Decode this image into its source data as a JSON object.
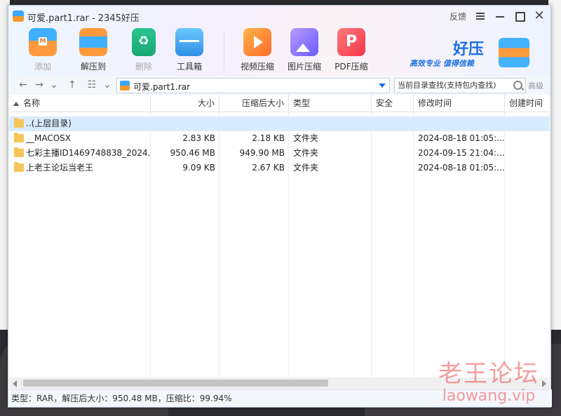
{
  "window": {
    "title": "可爱.part1.rar - 2345好压"
  },
  "titlebar": {
    "feedback_label": "反馈"
  },
  "toolbar": {
    "items": [
      {
        "label": "添加",
        "icon": "add-archive-icon",
        "enabled": false
      },
      {
        "label": "解压到",
        "icon": "extract-icon",
        "enabled": true
      },
      {
        "label": "删除",
        "icon": "delete-icon",
        "enabled": false
      },
      {
        "label": "工具箱",
        "icon": "toolbox-icon",
        "enabled": true
      },
      {
        "label": "视频压缩",
        "icon": "video-compress-icon",
        "enabled": true
      },
      {
        "label": "图片压缩",
        "icon": "image-compress-icon",
        "enabled": true
      },
      {
        "label": "PDF压缩",
        "icon": "pdf-compress-icon",
        "enabled": true
      }
    ]
  },
  "brand": {
    "name": "好压",
    "slogan": "高效专业 值得信赖"
  },
  "nav": {
    "path": "可爱.part1.rar",
    "search_placeholder": "当前目录查找(支持包内查找)",
    "advanced_label": "高级"
  },
  "columns": [
    "名称",
    "大小",
    "压缩后大小",
    "类型",
    "安全",
    "修改时间",
    "创建时间"
  ],
  "rows": [
    {
      "name": "..(上层目录)",
      "size": "",
      "packed": "",
      "type": "",
      "security": "",
      "modified": "",
      "created": "",
      "selected": true
    },
    {
      "name": "__MACOSX",
      "size": "2.83 KB",
      "packed": "2.18 KB",
      "type": "文件夹",
      "security": "",
      "modified": "2024-08-18 01:05:...",
      "created": ""
    },
    {
      "name": "七彩主播ID1469748838_2024...",
      "size": "950.46 MB",
      "packed": "949.90 MB",
      "type": "文件夹",
      "security": "",
      "modified": "2024-09-15 21:04:...",
      "created": ""
    },
    {
      "name": "上老王论坛当老王",
      "size": "9.09 KB",
      "packed": "2.67 KB",
      "type": "文件夹",
      "security": "",
      "modified": "2024-08-18 01:05:...",
      "created": ""
    }
  ],
  "status": {
    "text": "类型：RAR，解压后大小：950.48 MB，压缩比：99.94%"
  },
  "watermark": {
    "line1": "老王论坛",
    "line2": "laowang.vip"
  },
  "colors": {
    "accent": "#1d6fe0",
    "selection": "#d9ebff",
    "folder": "#f6c55a"
  }
}
